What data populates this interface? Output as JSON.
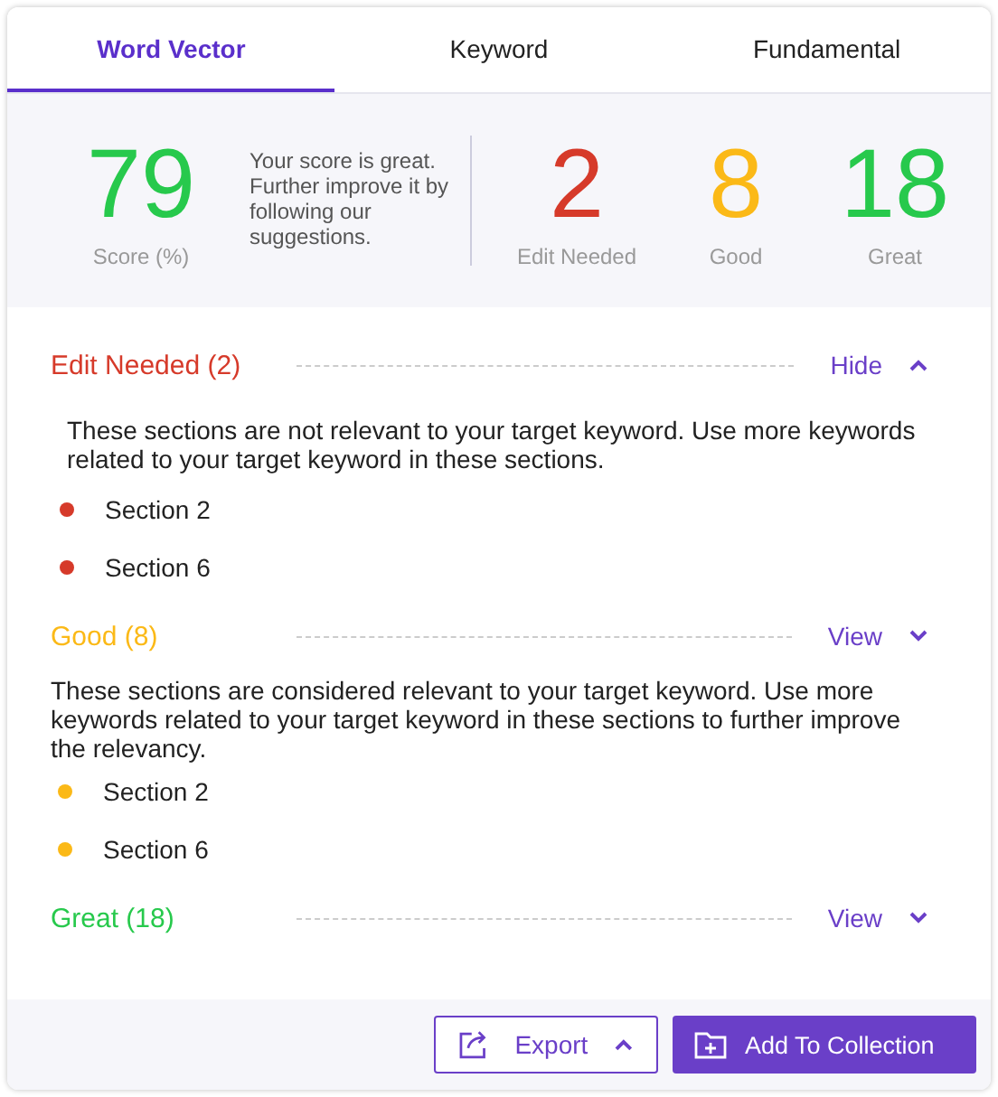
{
  "tabs": [
    {
      "label": "Word Vector",
      "selected": true
    },
    {
      "label": "Keyword",
      "selected": false
    },
    {
      "label": "Fundamental",
      "selected": false
    }
  ],
  "score": {
    "value": "79",
    "label": "Score (%)",
    "message": "Your score is great. Further improve it by following our suggestions."
  },
  "stats": [
    {
      "value": "2",
      "label": "Edit Needed",
      "color": "#d63a2a"
    },
    {
      "value": "8",
      "label": "Good",
      "color": "#fbb917"
    },
    {
      "value": "18",
      "label": "Great",
      "color": "#27c94c"
    }
  ],
  "sections": [
    {
      "title": "Edit Needed (2)",
      "color": "#d63a2a",
      "toggle": "Hide",
      "chevron_up": true,
      "expanded": true,
      "description": "These sections are not relevant to your target keyword. Use more keywords related to your target keyword in these sections.",
      "items": [
        "Section 2",
        "Section 6"
      ]
    },
    {
      "title": "Good (8)",
      "color": "#fbb917",
      "toggle": "View",
      "chevron_up": false,
      "expanded": true,
      "description": "These sections are considered relevant to your target keyword. Use more keywords related to your target keyword in these sections to further improve the relevancy.",
      "items": [
        "Section 2",
        "Section 6"
      ]
    },
    {
      "title": "Great (18)",
      "color": "#27c94c",
      "toggle": "View",
      "chevron_up": false,
      "expanded": false
    }
  ],
  "footer": {
    "export": "Export",
    "add": "Add To Collection"
  }
}
